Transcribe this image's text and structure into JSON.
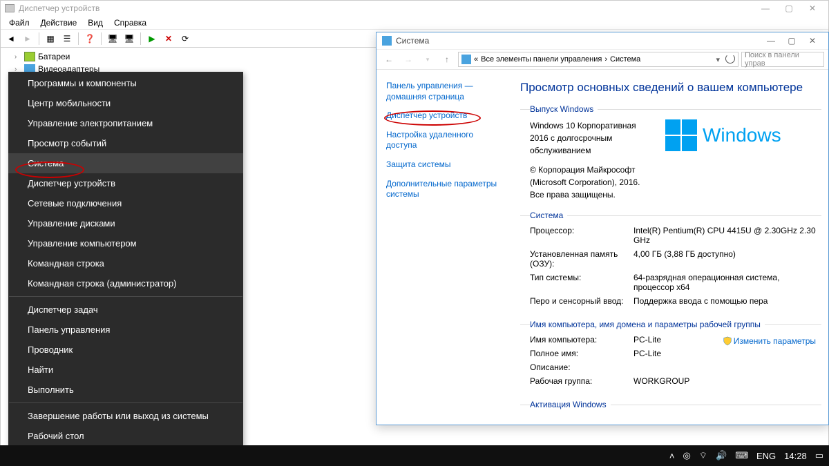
{
  "device_manager": {
    "title": "Диспетчер устройств",
    "menubar": [
      "Файл",
      "Действие",
      "Вид",
      "Справка"
    ],
    "tree": {
      "batteries": "Батареи",
      "video_adapters": "Видеоадаптеры"
    }
  },
  "winx_menu": {
    "items": [
      "Программы и компоненты",
      "Центр мобильности",
      "Управление электропитанием",
      "Просмотр событий",
      "Система",
      "Диспетчер устройств",
      "Сетевые подключения",
      "Управление дисками",
      "Управление компьютером",
      "Командная строка",
      "Командная строка (администратор)"
    ],
    "items2": [
      "Диспетчер задач",
      "Панель управления",
      "Проводник",
      "Найти",
      "Выполнить"
    ],
    "items3": [
      "Завершение работы или выход из системы",
      "Рабочий стол"
    ]
  },
  "system_window": {
    "title": "Система",
    "breadcrumb_root": "Все элементы панели управления",
    "breadcrumb_leaf": "Система",
    "search_placeholder": "Поиск в панели управ",
    "refresh_tooltip": "",
    "side": {
      "home": "Панель управления — домашняя страница",
      "devmgr": "Диспетчер устройств",
      "remote": "Настройка удаленного доступа",
      "protect": "Защита системы",
      "advanced": "Дополнительные параметры системы"
    },
    "heading": "Просмотр основных сведений о вашем компьютере",
    "edition_section": "Выпуск Windows",
    "edition_lines": [
      "Windows 10 Корпоративная 2016 с долгосрочным обслуживанием",
      "© Корпорация Майкрософт (Microsoft Corporation), 2016. Все права защищены."
    ],
    "windows_logo_text": "Windows ",
    "system_section": "Система",
    "system_rows": {
      "cpu_k": "Процессор:",
      "cpu_v": "Intel(R) Pentium(R) CPU 4415U @ 2.30GHz   2.30 GHz",
      "ram_k": "Установленная память (ОЗУ):",
      "ram_v": "4,00 ГБ (3,88 ГБ доступно)",
      "type_k": "Тип системы:",
      "type_v": "64-разрядная операционная система, процессор x64",
      "pen_k": "Перо и сенсорный ввод:",
      "pen_v": "Поддержка ввода с помощью пера"
    },
    "name_section": "Имя компьютера, имя домена и параметры рабочей группы",
    "name_rows": {
      "name_k": "Имя компьютера:",
      "name_v": "PC-Lite",
      "full_k": "Полное имя:",
      "full_v": "PC-Lite",
      "desc_k": "Описание:",
      "desc_v": "",
      "wg_k": "Рабочая группа:",
      "wg_v": "WORKGROUP"
    },
    "change_link": "Изменить параметры",
    "activation_section": "Активация Windows"
  },
  "taskbar": {
    "lang": "ENG",
    "clock": "14:28"
  }
}
